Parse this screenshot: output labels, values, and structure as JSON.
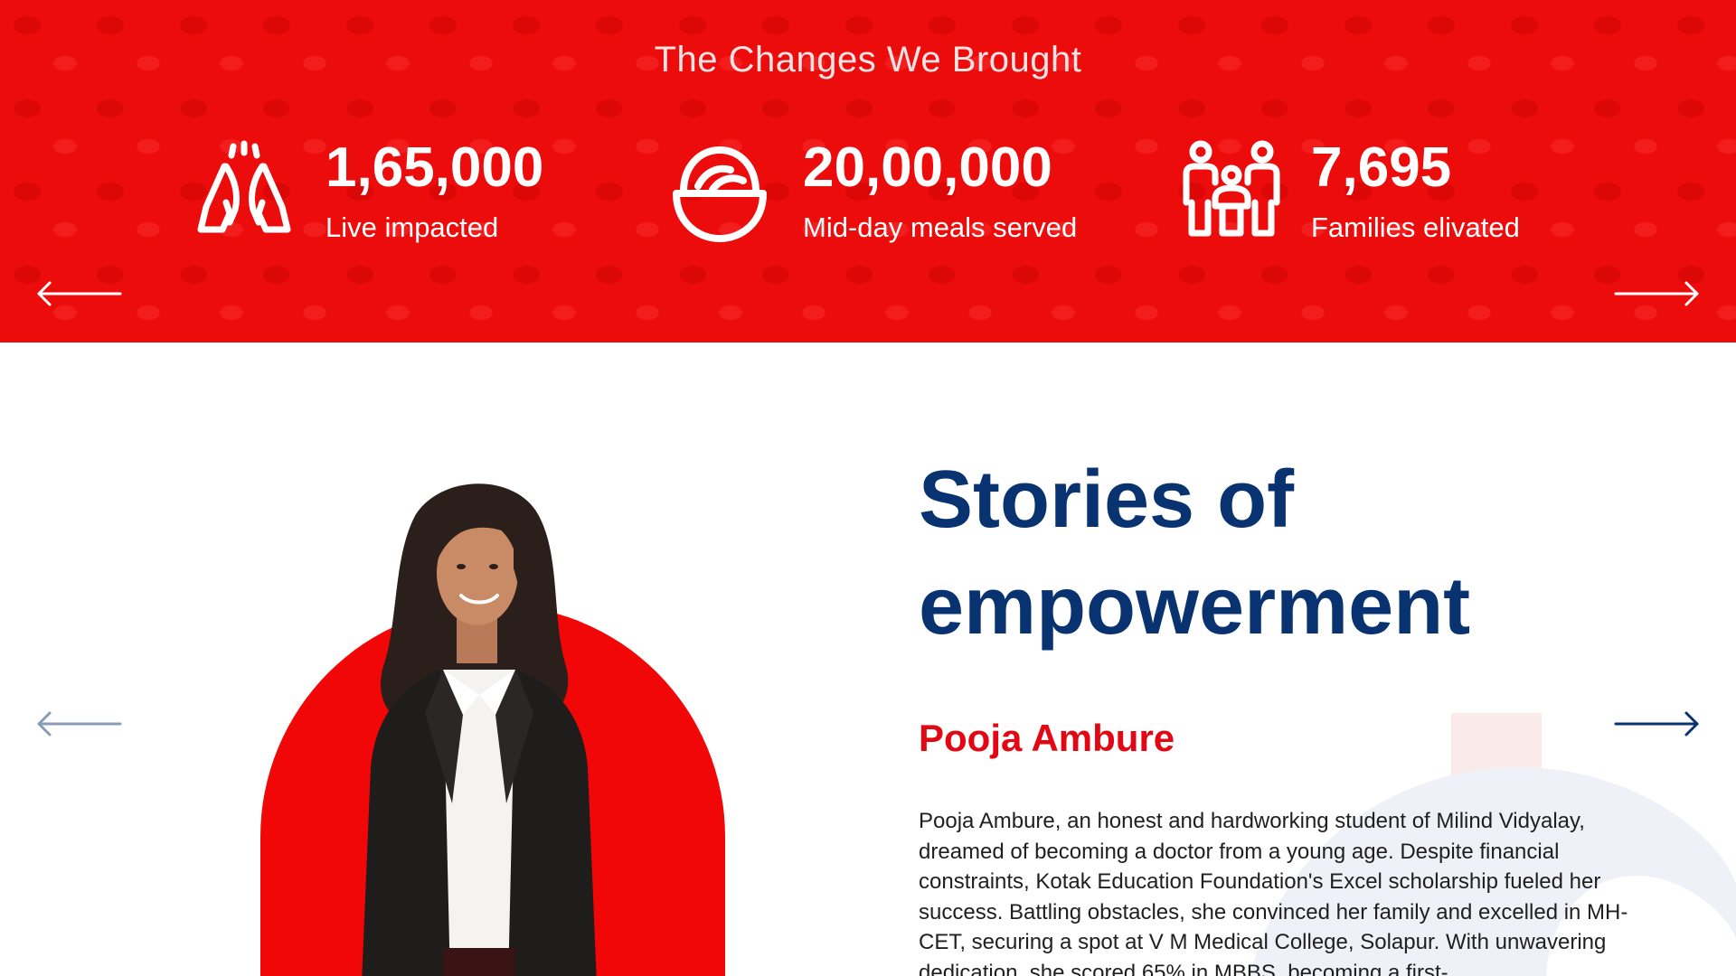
{
  "stats_section": {
    "title": "The Changes We Brought",
    "items": [
      {
        "icon": "praying-hands-icon",
        "value": "1,65,000",
        "label": "Live impacted"
      },
      {
        "icon": "meal-bowl-icon",
        "value": "20,00,000",
        "label": "Mid-day meals served"
      },
      {
        "icon": "family-icon",
        "value": "7,695",
        "label": "Families elivated"
      }
    ],
    "prev_icon": "arrow-left-icon",
    "next_icon": "arrow-right-icon",
    "background_color": "#ed0c0c"
  },
  "stories_section": {
    "heading": "Stories of empowerment",
    "name": "Pooja Ambure",
    "text": "Pooja Ambure, an honest and hardworking student of Milind Vidyalay, dreamed of becoming a doctor from a young age. Despite financial constraints, Kotak Education Foundation's Excel scholarship fueled her success. Battling obstacles, she convinced her family and excelled in MH-CET, securing a spot at V M Medical College, Solapur. With unwavering dedication, she scored 65% in MBBS, becoming a first-",
    "prev_icon": "arrow-left-icon",
    "next_icon": "arrow-right-icon",
    "heading_color": "#083370",
    "name_color": "#e30613",
    "accent_color": "#f10707"
  }
}
